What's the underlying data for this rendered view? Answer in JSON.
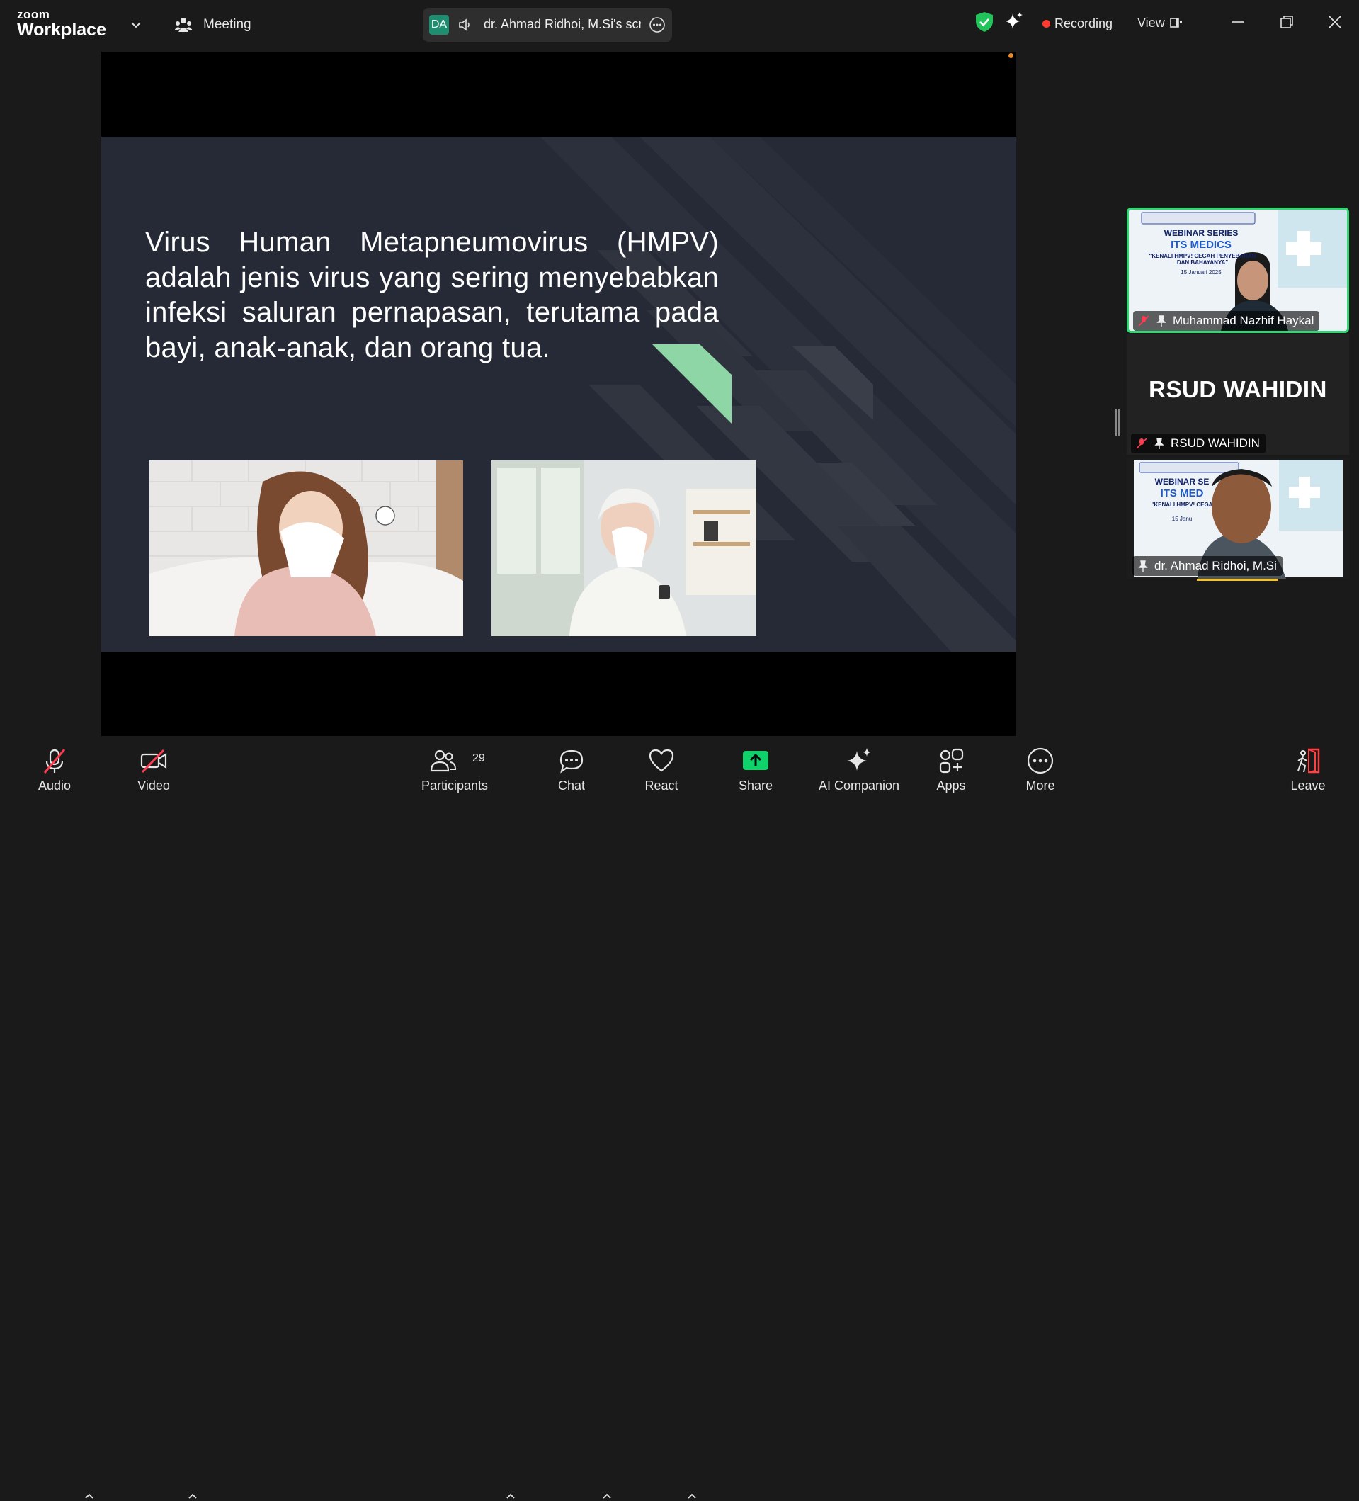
{
  "app": {
    "brand_top": "zoom",
    "brand_bottom": "Workplace",
    "meeting_label": "Meeting"
  },
  "share_indicator": {
    "initials": "DA",
    "name": "dr. Ahmad Ridhoi, M.Si's scr"
  },
  "status": {
    "recording_label": "Recording",
    "view_label": "View"
  },
  "slide": {
    "text": "Virus Human Metapneumovirus (HMPV) adalah jenis virus yang sering menyebabkan infeksi saluran pernapasan, terutama pada bayi, anak-anak, dan orang tua."
  },
  "participants_panel": {
    "tiles": [
      {
        "name": "Muhammad Nazhif Haykal",
        "banner_title": "WEBINAR SERIES",
        "banner_sub": "ITS MEDICS",
        "banner_tag": "\"KENALI HMPV! CEGAH PENYEBARAN DAN BAHAYANYA\"",
        "banner_date": "15 Januari 2025"
      },
      {
        "name": "RSUD WAHIDIN",
        "display_text": "RSUD WAHIDIN"
      },
      {
        "name": "dr. Ahmad Ridhoi, M.Si",
        "banner_title": "WEBINAR SE",
        "banner_sub": "ITS MED",
        "banner_tag": "\"KENALI HMPV! CEGA",
        "banner_date": "15 Janu"
      }
    ]
  },
  "toolbar": {
    "audio": "Audio",
    "video": "Video",
    "participants": "Participants",
    "participants_count": "29",
    "chat": "Chat",
    "react": "React",
    "share": "Share",
    "ai_companion": "AI Companion",
    "apps": "Apps",
    "more": "More",
    "leave": "Leave"
  },
  "colors": {
    "active_speaker_border": "#2fd871",
    "share_button": "#0fd26b",
    "recording_dot": "#ff3b30",
    "leave_icon": "#ff4040",
    "muted_slash": "#ff3b50"
  }
}
